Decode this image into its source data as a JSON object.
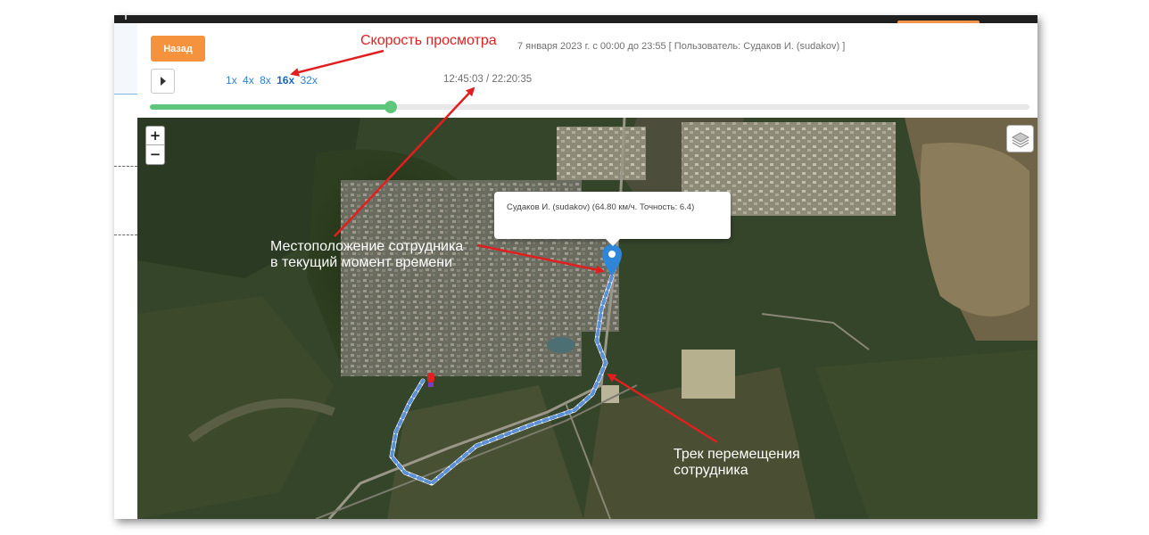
{
  "panel": {
    "back_button": "Назад",
    "session_info": "7 января 2023 г. с 00:00 до 23:55 [ Пользователь: Судаков И. (sudakov) ]",
    "speed_options": [
      "1x",
      "4x",
      "8x",
      "16x",
      "32x"
    ],
    "active_speed": "16x",
    "time_current": "12:45:03",
    "time_total": "22:20:35",
    "time_separator": " / ",
    "playback_progress": 0.274,
    "progress_color": "#5ec77c",
    "accent_color": "#f4923e",
    "play_icon": "play-icon"
  },
  "map": {
    "zoom_in": "+",
    "zoom_out": "−",
    "layers_icon": "layers-icon",
    "popup_text": "Судаков И. (sudakov) (64.80 км/ч. Точность: 6.4)",
    "marker_icon": "location-pin-icon",
    "start_marker_icon": "start-marker-icon",
    "track_color": "#5b8fd6"
  },
  "annotations": {
    "speed_label": "Скорость просмотра",
    "location_label_line1": "Местоположение сотрудника",
    "location_label_line2": "в текущий момент времени",
    "track_label_line1": "Трек перемещения",
    "track_label_line2": "сотрудника",
    "arrow_color": "#e11f1f"
  }
}
